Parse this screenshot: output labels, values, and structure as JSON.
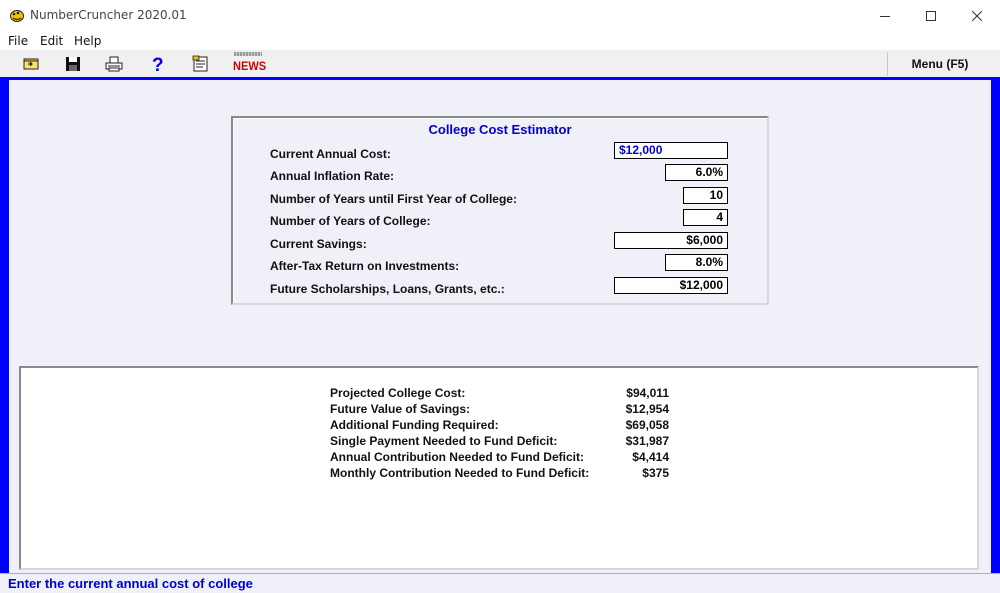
{
  "window": {
    "title": "NumberCruncher 2020.01"
  },
  "menubar": {
    "items": [
      "File",
      "Edit",
      "Help"
    ]
  },
  "toolbar": {
    "icons": [
      "open-icon",
      "save-icon",
      "print-icon",
      "help-icon",
      "notes-icon"
    ],
    "news_label": "NEWS",
    "menu_label": "Menu (F5)"
  },
  "colors": {
    "accent_blue": "#0000ff",
    "title_blue": "#0000cc",
    "news_red": "#d00000",
    "panel_bg": "#f0f0f8"
  },
  "estimator": {
    "title": "College Cost Estimator",
    "fields": [
      {
        "label": "Current Annual Cost:",
        "value": "$12,000"
      },
      {
        "label": "Annual Inflation Rate:",
        "value": "6.0%"
      },
      {
        "label": "Number of Years until First Year of College:",
        "value": "10"
      },
      {
        "label": "Number of Years of College:",
        "value": "4"
      },
      {
        "label": "Current Savings:",
        "value": "$6,000"
      },
      {
        "label": "After-Tax Return on Investments:",
        "value": "8.0%"
      },
      {
        "label": "Future Scholarships, Loans, Grants, etc.:",
        "value": "$12,000"
      }
    ]
  },
  "results": [
    {
      "label": "Projected College Cost:",
      "value": "$94,011"
    },
    {
      "label": "Future Value of Savings:",
      "value": "$12,954"
    },
    {
      "label": "Additional Funding Required:",
      "value": "$69,058"
    },
    {
      "label": "Single Payment Needed to Fund Deficit:",
      "value": "$31,987"
    },
    {
      "label": "Annual Contribution Needed to Fund Deficit:",
      "value": "$4,414"
    },
    {
      "label": "Monthly Contribution Needed to Fund Deficit:",
      "value": "$375"
    }
  ],
  "status": {
    "text": "Enter the current annual cost of college"
  }
}
